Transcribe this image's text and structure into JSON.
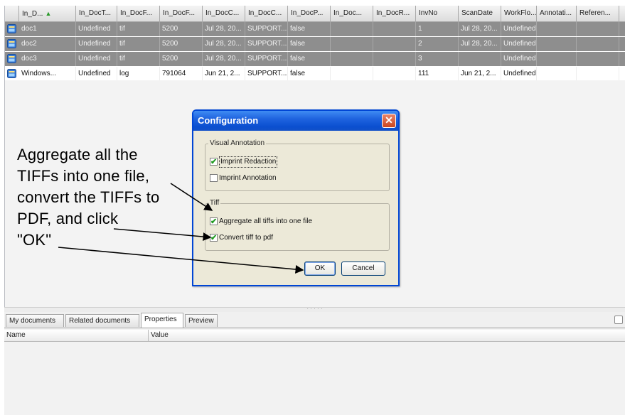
{
  "grid": {
    "columns": [
      {
        "label": "In_D...",
        "sorted": true
      },
      {
        "label": "In_DocT..."
      },
      {
        "label": "In_DocF..."
      },
      {
        "label": "In_DocF..."
      },
      {
        "label": "In_DocC..."
      },
      {
        "label": "In_DocC..."
      },
      {
        "label": "In_DocP..."
      },
      {
        "label": "In_Doc..."
      },
      {
        "label": "In_DocR..."
      },
      {
        "label": "InvNo"
      },
      {
        "label": "ScanDate"
      },
      {
        "label": "WorkFlo..."
      },
      {
        "label": "Annotati..."
      },
      {
        "label": "Referen..."
      }
    ],
    "rows": [
      {
        "selected": true,
        "cells": [
          "doc1",
          "Undefined",
          "tif",
          "5200",
          "Jul 28, 20...",
          "SUPPORT...",
          "false",
          "",
          "",
          "1",
          "Jul 28, 20...",
          "Undefined",
          "",
          ""
        ]
      },
      {
        "selected": true,
        "cells": [
          "doc2",
          "Undefined",
          "tif",
          "5200",
          "Jul 28, 20...",
          "SUPPORT...",
          "false",
          "",
          "",
          "2",
          "Jul 28, 20...",
          "Undefined",
          "",
          ""
        ]
      },
      {
        "selected": true,
        "cells": [
          "doc3",
          "Undefined",
          "tif",
          "5200",
          "Jul 28, 20...",
          "SUPPORT...",
          "false",
          "",
          "",
          "3",
          "",
          "Undefined",
          "",
          ""
        ]
      },
      {
        "selected": false,
        "cells": [
          "Windows...",
          "Undefined",
          "log",
          "791064",
          "Jun 21, 2...",
          "SUPPORT...",
          "false",
          "",
          "",
          "111",
          "Jun 21, 2...",
          "Undefined",
          "",
          ""
        ]
      }
    ]
  },
  "tabs": [
    {
      "label": "My documents",
      "active": false
    },
    {
      "label": "Related documents",
      "active": false
    },
    {
      "label": "Properties",
      "active": true
    },
    {
      "label": "Preview",
      "active": false
    }
  ],
  "properties": {
    "name_header": "Name",
    "value_header": "Value"
  },
  "dialog": {
    "title": "Configuration",
    "close_label": "✕",
    "visual_annotation": {
      "legend": "Visual Annotation",
      "imprint_redaction": {
        "label": "Imprint Redaction",
        "checked": true
      },
      "imprint_annotation": {
        "label": "Imprint Annotation",
        "checked": false
      }
    },
    "tiff": {
      "legend": "Tiff",
      "aggregate": {
        "label": "Aggregate all tiffs into one file",
        "checked": true
      },
      "convert": {
        "label": "Convert tiff to pdf",
        "checked": true
      }
    },
    "ok_label": "OK",
    "cancel_label": "Cancel"
  },
  "callout": {
    "lines": [
      "Aggregate all the",
      "TIFFs into one file,",
      "convert the TIFFs to",
      "PDF, and click",
      "\"OK\""
    ]
  },
  "colors": {
    "selected_row": "#8e8e8e",
    "titlebar": "#1f63df",
    "close_button": "#d6542c",
    "check": "#1f9a1f"
  }
}
